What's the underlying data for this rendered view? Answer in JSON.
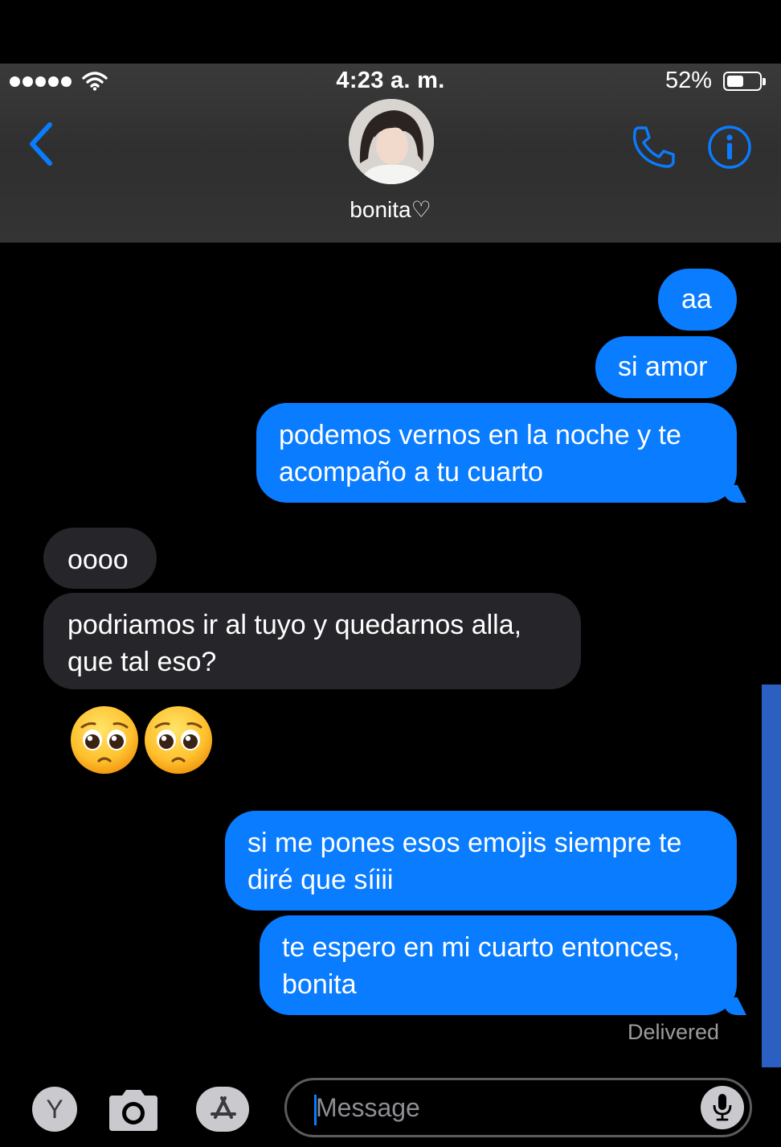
{
  "status_bar": {
    "time": "4:23 a. m.",
    "battery_percent": "52%",
    "battery_level": 0.52
  },
  "header": {
    "contact_name": "bonita♡",
    "icons": [
      "back-chevron-icon",
      "phone-icon",
      "info-icon",
      "avatar"
    ]
  },
  "colors": {
    "accent": "#0a7cff",
    "outgoing_bubble": "#0a7cff",
    "incoming_bubble": "#262529",
    "header_bg": "#333333"
  },
  "messages": [
    {
      "direction": "outgoing",
      "text": "aa"
    },
    {
      "direction": "outgoing",
      "text": "si amor"
    },
    {
      "direction": "outgoing",
      "lines": [
        "podemos vernos en la noche y te",
        "acompaño a tu cuarto"
      ]
    },
    {
      "direction": "incoming",
      "text": "oooo"
    },
    {
      "direction": "incoming",
      "lines": [
        "podriamos ir al tuyo y quedarnos alla,",
        "que tal eso?"
      ]
    },
    {
      "direction": "incoming",
      "emoji": "🥺🥺"
    },
    {
      "direction": "outgoing",
      "lines": [
        "si me pones esos emojis siempre te",
        "diré que síiii"
      ]
    },
    {
      "direction": "outgoing",
      "lines": [
        "te espero en mi cuarto entonces,",
        "bonita"
      ]
    }
  ],
  "delivered_label": "Delivered",
  "input_bar": {
    "apps_letter": "Y",
    "placeholder": "Message",
    "icons": [
      "camera-icon",
      "app-store-icon",
      "microphone-icon"
    ]
  }
}
